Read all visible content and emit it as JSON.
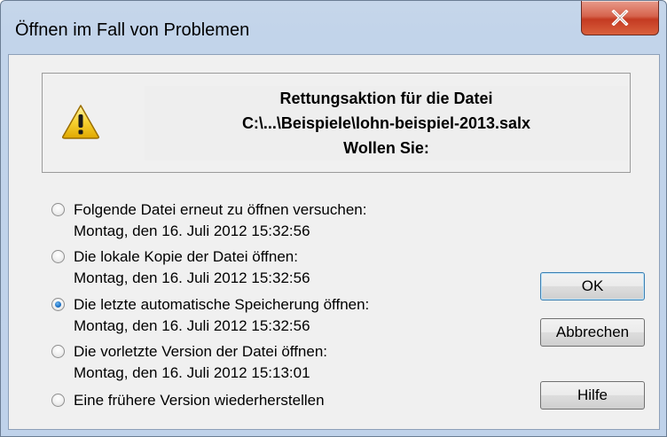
{
  "window": {
    "title": "Öffnen im Fall von Problemen",
    "close_icon": "close-icon"
  },
  "message": {
    "line1": "Rettungsaktion für die Datei",
    "line2": "C:\\...\\Beispiele\\lohn-beispiel-2013.salx",
    "line3": "Wollen Sie:",
    "icon": "warning-icon"
  },
  "options": [
    {
      "label": "Folgende Datei erneut zu öffnen versuchen:",
      "detail": "Montag, den 16. Juli 2012 15:32:56",
      "checked": false
    },
    {
      "label": "Die lokale Kopie der Datei öffnen:",
      "detail": "Montag, den 16. Juli 2012 15:32:56",
      "checked": false
    },
    {
      "label": "Die letzte automatische Speicherung öffnen:",
      "detail": "Montag, den 16. Juli 2012 15:32:56",
      "checked": true
    },
    {
      "label": "Die vorletzte Version der Datei öffnen:",
      "detail": "Montag, den 16. Juli 2012 15:13:01",
      "checked": false
    },
    {
      "label": "Eine frühere Version wiederherstellen",
      "detail": "",
      "checked": false
    }
  ],
  "buttons": {
    "ok": "OK",
    "cancel": "Abbrechen",
    "help": "Hilfe"
  }
}
